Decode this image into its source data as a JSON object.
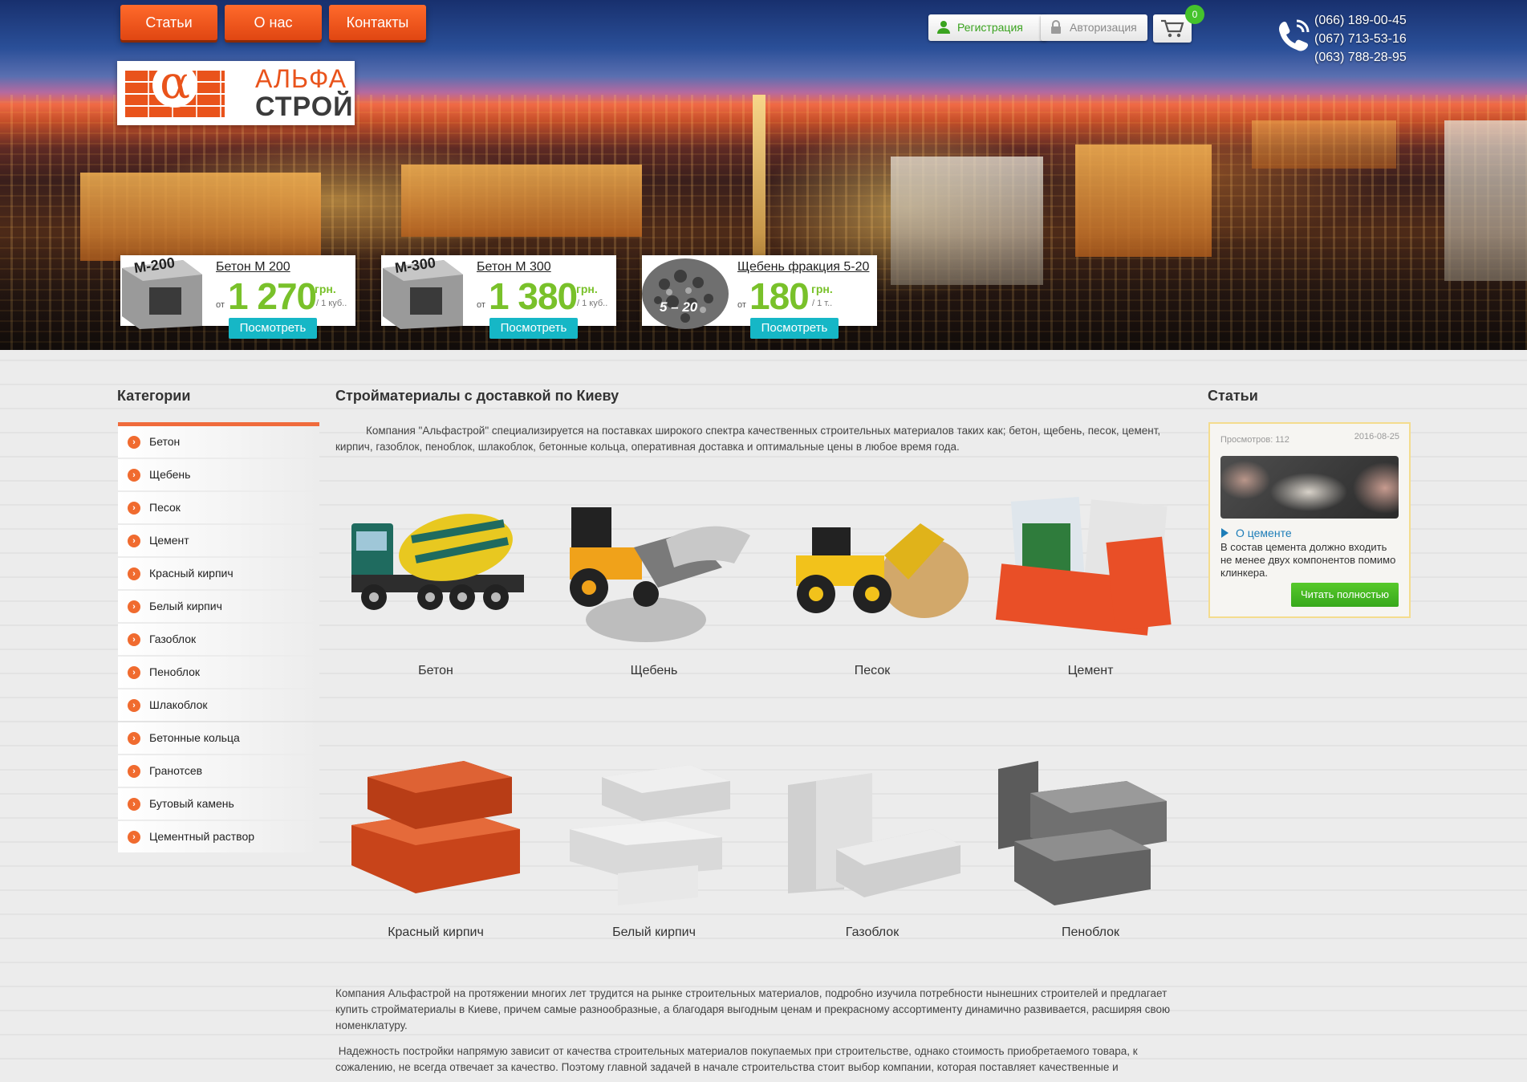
{
  "nav": [
    "Статьи",
    "О нас",
    "Контакты"
  ],
  "logo": {
    "line1": "АЛЬФА",
    "line2": "СТРОЙ",
    "symbol": "α"
  },
  "auth": {
    "register": "Регистрация",
    "login": "Авторизация"
  },
  "cart": {
    "count": "0"
  },
  "phones": [
    "(066) 189-00-45",
    "(067) 713-53-16",
    "(063) 788-28-95"
  ],
  "promos": [
    {
      "badge": "М-200",
      "title": "Бетон М 200",
      "from": "от",
      "price": "1 270",
      "currency": "грн.",
      "unit": "/ 1 куб..",
      "button": "Посмотреть"
    },
    {
      "badge": "М-300",
      "title": "Бетон М 300",
      "from": "от",
      "price": "1 380",
      "currency": "грн.",
      "unit": "/ 1 куб..",
      "button": "Посмотреть"
    },
    {
      "badge": "5 – 20",
      "title": "Щебень фракция 5-20",
      "from": "от",
      "price": "180",
      "currency": "грн.",
      "unit": "/ 1 т..",
      "button": "Посмотреть"
    }
  ],
  "sidebar": {
    "title": "Категории",
    "items": [
      "Бетон",
      "Щебень",
      "Песок",
      "Цемент",
      "Красный кирпич",
      "Белый кирпич",
      "Газоблок",
      "Пеноблок",
      "Шлакоблок",
      "Бетонные кольца",
      "Гранотсев",
      "Бутовый камень",
      "Цементный раствор"
    ]
  },
  "main": {
    "title": "Стройматериалы с доставкой по Киеву",
    "intro": "Компания \"Альфастрой\" специализируется на поставках широкого спектра качественных строительных материалов таких как; бетон, щебень, песок, цемент, кирпич, газоблок, пеноблок, шлакоблок, бетонные кольца, оперативная доставка и оптимальные цены в любое время года.",
    "products": [
      "Бетон",
      "Щебень",
      "Песок",
      "Цемент",
      "Красный кирпич",
      "Белый кирпич",
      "Газоблок",
      "Пеноблок"
    ],
    "para1": "Компания Альфастрой на протяжении многих лет трудится на рынке строительных материалов, подробно изучила потребности нынешних строителей и предлагает купить стройматериалы в Киеве, причем самые разнообразные, а благодаря выгодным ценам и прекрасному ассортименту динамично развивается, расширяя свою номенклатуру.",
    "para2": " Надежность постройки напрямую зависит от качества строительных материалов покупаемых при строительстве, однако стоимость приобретаемого товара, к сожалению, не всегда отвечает за качество. Поэтому главной задачей в начале строительства стоит выбор компании, которая поставляет качественные и"
  },
  "articles": {
    "title": "Статьи",
    "views": "Просмотров: 112",
    "date": "2016-08-25",
    "link": "О цементе",
    "text": "В состав цемента должно входить не менее двух компонентов помимо клинкера.",
    "button": "Читать полностью"
  },
  "colors": {
    "accent": "#e9531b",
    "green": "#79c12a",
    "teal": "#16b7c6",
    "button_green": "#37a81c"
  }
}
